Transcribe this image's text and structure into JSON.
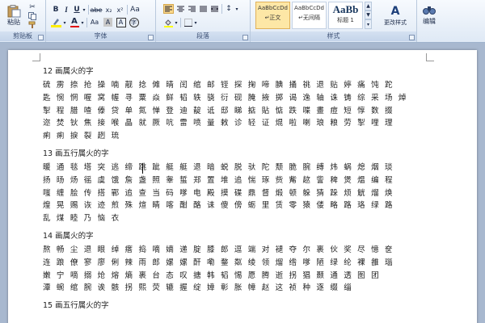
{
  "ribbon": {
    "clipboard": {
      "label": "剪贴板",
      "paste_label": "粘贴"
    },
    "font": {
      "label": "字体"
    },
    "paragraph": {
      "label": "段落"
    },
    "styles": {
      "label": "样式",
      "items": [
        {
          "sample": "AaBbCcDd",
          "name": "↵正文"
        },
        {
          "sample": "AaBbCcDd",
          "name": "↵无间隔"
        },
        {
          "sample": "AaBb",
          "name": "标题 1"
        }
      ],
      "change_styles_label": "更改样式"
    },
    "editing": {
      "label": "编辑"
    }
  },
  "document": {
    "sections": [
      {
        "heading": "12 画属火的字",
        "lines": [
          "硫 雳 捺 抢 操 喃 靓 捻 傩 晴 闰 绾 邮 铚 探 掬 啼 腆 捅 祧 退 贴 婷 痛 饨 跎",
          "匙 惋 惘 喔 窝 幄 寻 粟 焱 鲜 韬 轶 骁 衍 砚 腌 掖 掷 谒 逸 轴 诛 铸 综 采 场 焯",
          "掣 程 腊 喳 傣 贷 单 氮 惮 登 迪 靛 诋 邸 睇 掂 貼 惦 跌 喋 畫 痘 短 惇 数 掇",
          "迩 焚 钬 焦 接 喉 晶 就 厥 吭 雷 喷 量 敕 诊 轻 证 焜 啦 喇 琅 粮 劳 掣 哩 理",
          "痢 痢 捩 裂 趔 琉"
        ]
      },
      {
        "heading": "13 画五行属火的字",
        "lines": [
          "暖 通 毯 塔 突 逃 缔 跳 跐 艇 艇 退 暗 蜕 脱 驮 陀 颓 脆 腕 缚 炜 蜗 熄 烟 琰",
          "扬 旸 炀 徭 虞 饿 詹 盏 照 睾 蜇 郑 置 堆 追 惴 琢 赀 觜 趑 訾 稗 煲 煴 编 程",
          "嗤 缠 脍 传 搭 鄲 追 查 当 码 嗲 电 殿 摸 碟 鼎 督 煅 顿 躲 猜 跺 烦 觥 熘 焕",
          "煌 晃 赐 诙 迹 煎 殊 煊 睛 喀 酣 酪 诔 傻 傍 蛎 里 赁 零 猿 偻 略 路 珞 绿 路",
          "乱 煤 睦 乃 恼 衣"
        ]
      },
      {
        "heading": "14 画属火的字",
        "lines": [
          "熬 畅 尘 退 眼 绰 瘩 捣 嘀 嫡 递 腚 膝 郎 逗 端 对 褪 夺 尔 裹 伙 奖 尽 憶 奁",
          "连 踉 僚 寥 廖 俐 辣 雨 郎 嫘 嫘 酐 嘞 鍪 粼 绫 领 熘 绺 嗲 陋 绿 纶 裸 雒 瑙",
          "嫩 宁 嘀 搦 炝 熔 熵 裹 台 态 叹 搪 韩 韬 惕 愿 腾 逝 拐 猖 颞 通 透 图 团",
          "潭 蜿 绾 腕 诶 骸 拐 熙 荧 辘 握 绽 嫜 彰 胀 幛 赵 这 祯 种 逐 缀 缁"
        ]
      },
      {
        "heading": "15 画五行属火的字",
        "lines": []
      }
    ]
  }
}
